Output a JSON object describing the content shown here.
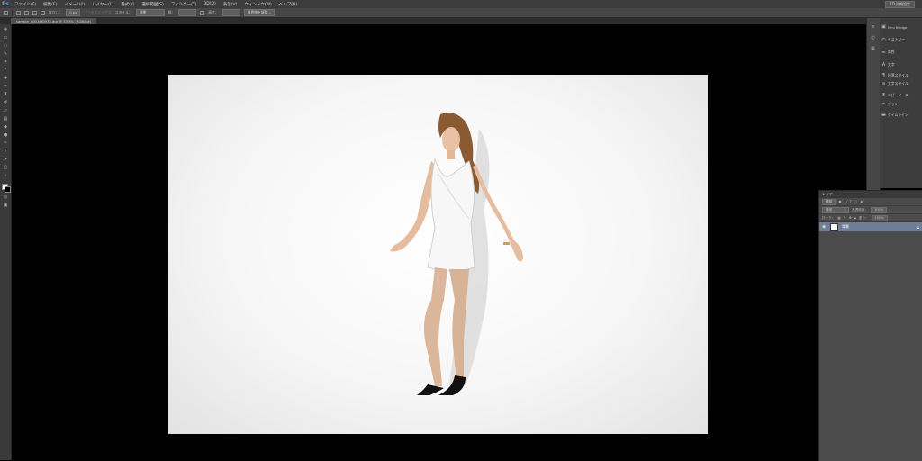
{
  "app": {
    "logo": "Ps"
  },
  "menu": [
    "ファイル(F)",
    "編集(E)",
    "イメージ(I)",
    "レイヤー(L)",
    "書式(Y)",
    "選択範囲(S)",
    "フィルター(T)",
    "3D(D)",
    "表示(V)",
    "ウィンドウ(W)",
    "ヘルプ(H)"
  ],
  "workspace": "3D 初期設定",
  "options": {
    "feather_label": "ぼかし：",
    "feather_value": "0 px",
    "antialias_label": "アンチエイリアス",
    "style_label": "スタイル：",
    "style_value": "標準",
    "width_label": "幅：",
    "height_label": "高さ：",
    "refine_edge": "境界線を調整..."
  },
  "document_tab": "sample_00016f0978.jpg @ 33.3% (RGB/8#)",
  "right_dock": {
    "items": [
      {
        "icon": "mini-bridge-icon",
        "label": "Mini Bridge"
      },
      {
        "icon": "history-icon",
        "label": "ヒストリー"
      },
      {
        "icon": "properties-icon",
        "label": "属性"
      },
      {
        "icon": "character-icon",
        "label": "文字"
      },
      {
        "icon": "character-style-icon",
        "label": "段落スタイル"
      },
      {
        "icon": "paragraph-style-icon",
        "label": "文字スタイル"
      },
      {
        "icon": "clone-source-icon",
        "label": "コピーソース"
      },
      {
        "icon": "brush-icon",
        "label": "ブラシ"
      },
      {
        "icon": "timeline-icon",
        "label": "タイムライン"
      }
    ]
  },
  "layers_panel": {
    "title": "レイヤー",
    "filter_label": "種類",
    "blend_mode": "通常",
    "opacity_label": "不透明度：",
    "opacity_value": "100%",
    "lock_label": "ロック：",
    "fill_label": "塗り：",
    "fill_value": "100%",
    "layer_name": "背景"
  }
}
